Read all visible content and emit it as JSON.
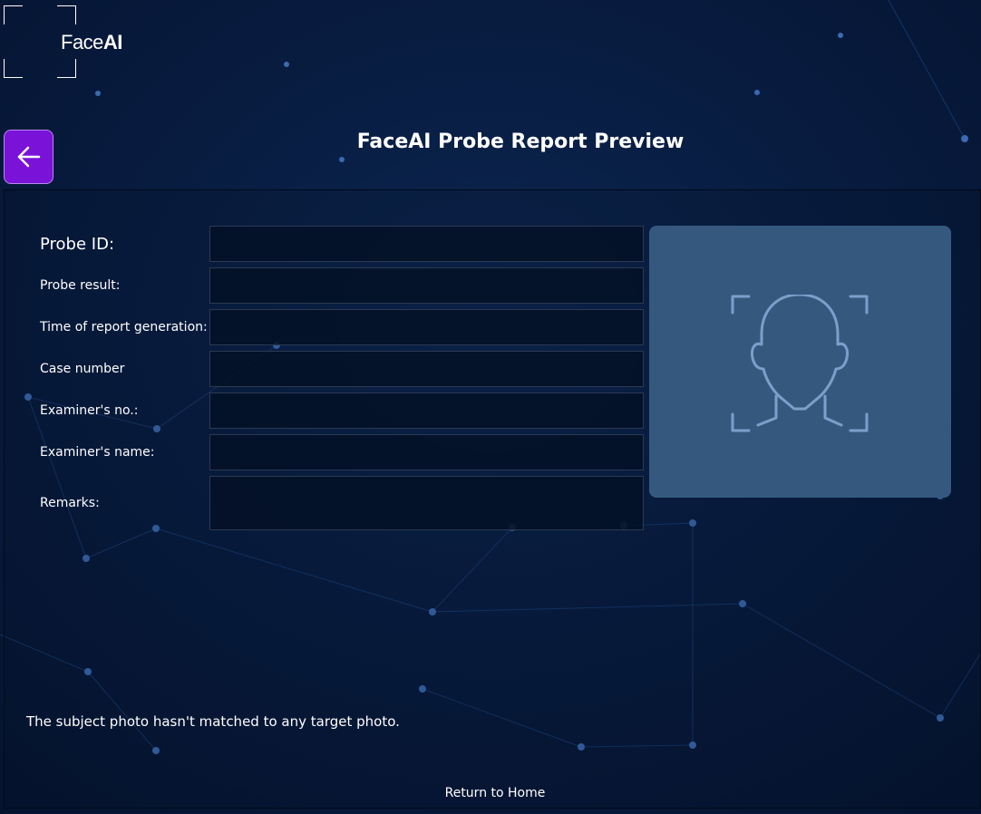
{
  "brand": {
    "logo_text_light": "Face",
    "logo_text_bold": "AI"
  },
  "header": {
    "back_icon": "arrow-left-icon",
    "title": "FaceAI Probe Report Preview"
  },
  "form": {
    "probe_id_label": "Probe ID:",
    "probe_id_value": "",
    "probe_result_label": "Probe result:",
    "probe_result_value": "",
    "time_label": "Time of report generation:",
    "time_value": "",
    "case_number_label": "Case number",
    "case_number_value": "",
    "examiner_no_label": "Examiner's no.:",
    "examiner_no_value": "",
    "examiner_name_label": "Examiner's name:",
    "examiner_name_value": "",
    "remarks_label": "Remarks:",
    "remarks_value": ""
  },
  "photo": {
    "placeholder_icon": "face-scan-icon"
  },
  "status": {
    "message": "The subject photo hasn't matched to any target photo."
  },
  "footer": {
    "return_home": "Return to Home"
  },
  "colors": {
    "background": "#071a3a",
    "accent": "#7a12d8",
    "photo_box": "#35597e",
    "icon_stroke": "#7b9fcb"
  }
}
